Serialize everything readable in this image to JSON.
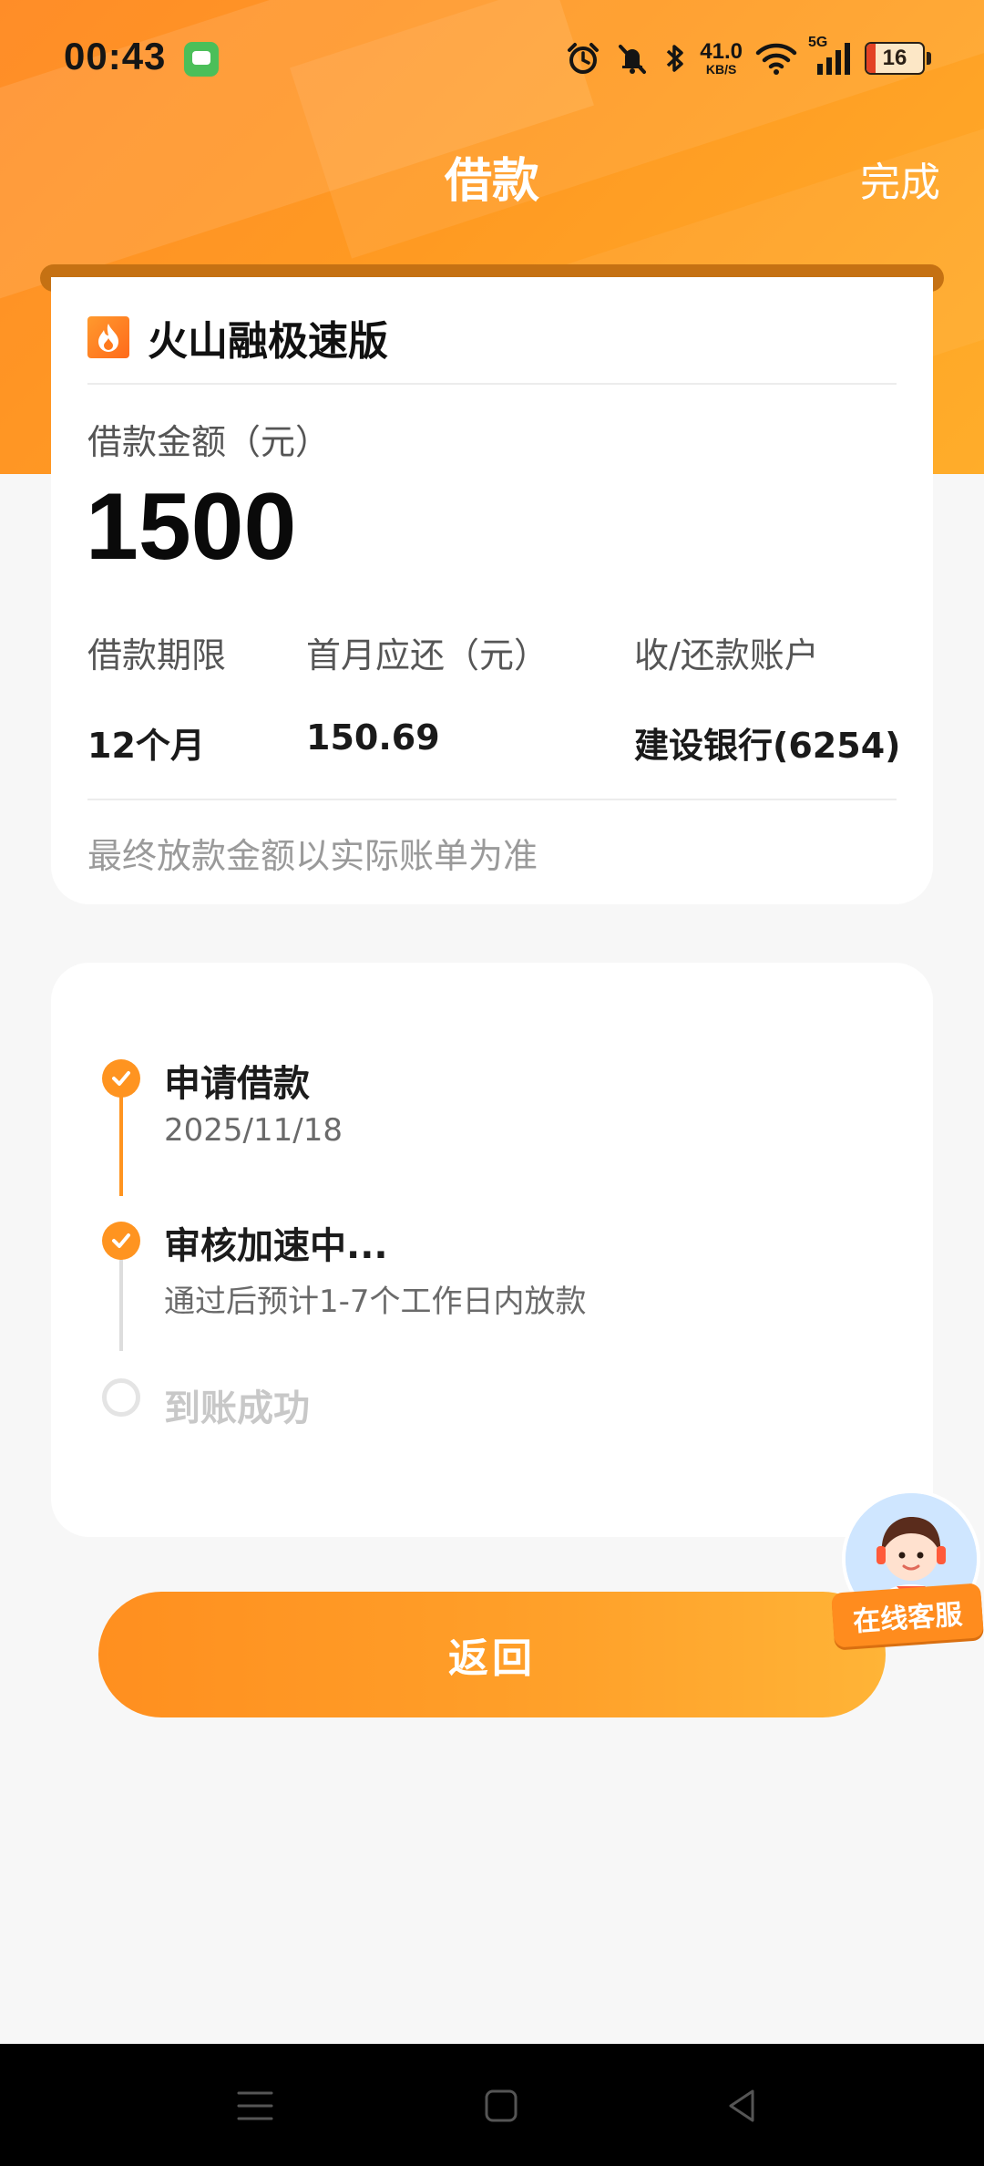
{
  "status_bar": {
    "time": "00:43",
    "net_speed_value": "41.0",
    "net_speed_unit": "KB/S",
    "network_type": "5G",
    "battery_percent": "16",
    "battery_level": 0.16
  },
  "header": {
    "title": "借款",
    "done_label": "完成"
  },
  "loan_card": {
    "product_name": "火山融极速版",
    "amount_label": "借款金额（元）",
    "amount_value": "1500",
    "columns": [
      {
        "label": "借款期限",
        "value": "12个月"
      },
      {
        "label": "首月应还（元）",
        "value": "150.69"
      },
      {
        "label": "收/还款账户",
        "value": "建设银行(6254)"
      }
    ],
    "note": "最终放款金额以实际账单为准"
  },
  "progress": {
    "steps": [
      {
        "title": "申请借款",
        "subtitle": "2025/11/18",
        "status": "done"
      },
      {
        "title": "审核加速中...",
        "subtitle": "通过后预计1-7个工作日内放款",
        "status": "done"
      },
      {
        "title": "到账成功",
        "subtitle": "",
        "status": "pending"
      }
    ]
  },
  "actions": {
    "back_label": "返回"
  },
  "customer_service": {
    "label": "在线客服"
  },
  "colors": {
    "accent": "#ff9420",
    "done_line": "#ff9420",
    "pending_line": "#dddddd"
  }
}
